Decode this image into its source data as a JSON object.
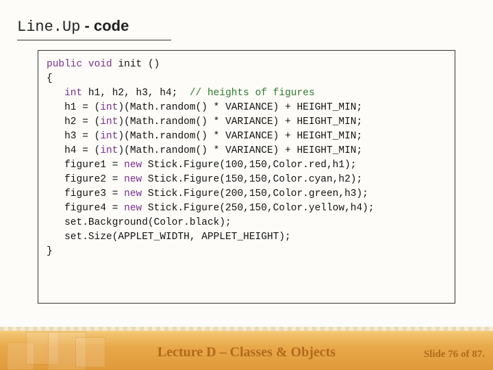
{
  "title": {
    "mono1": "Line.Up",
    "sep": " - ",
    "bold": "code"
  },
  "code": {
    "l01a": "public",
    "l01b": " void",
    "l01c": " init ()",
    "l02": "{",
    "l03a": "   int",
    "l03b": " h1, h2, h3, h4;  ",
    "l03c": "// heights of figures",
    "blank1": "",
    "l05a": "   h1 = (",
    "l05b": "int",
    "l05c": ")(Math.random() * VARIANCE) + HEIGHT_MIN;",
    "l06a": "   h2 = (",
    "l06b": "int",
    "l06c": ")(Math.random() * VARIANCE) + HEIGHT_MIN;",
    "l07a": "   h3 = (",
    "l07b": "int",
    "l07c": ")(Math.random() * VARIANCE) + HEIGHT_MIN;",
    "l08a": "   h4 = (",
    "l08b": "int",
    "l08c": ")(Math.random() * VARIANCE) + HEIGHT_MIN;",
    "blank2": "",
    "l10a": "   figure1 = ",
    "l10b": "new",
    "l10c": " Stick.Figure(100,150,Color.red,h1);",
    "l11a": "   figure2 = ",
    "l11b": "new",
    "l11c": " Stick.Figure(150,150,Color.cyan,h2);",
    "l12a": "   figure3 = ",
    "l12b": "new",
    "l12c": " Stick.Figure(200,150,Color.green,h3);",
    "l13a": "   figure4 = ",
    "l13b": "new",
    "l13c": " Stick.Figure(250,150,Color.yellow,h4);",
    "l14": "   set.Background(Color.black);",
    "l15": "   set.Size(APPLET_WIDTH, APPLET_HEIGHT);",
    "l16": "}"
  },
  "footer": "Lecture D – Classes & Objects",
  "slide": "Slide 76 of 87."
}
